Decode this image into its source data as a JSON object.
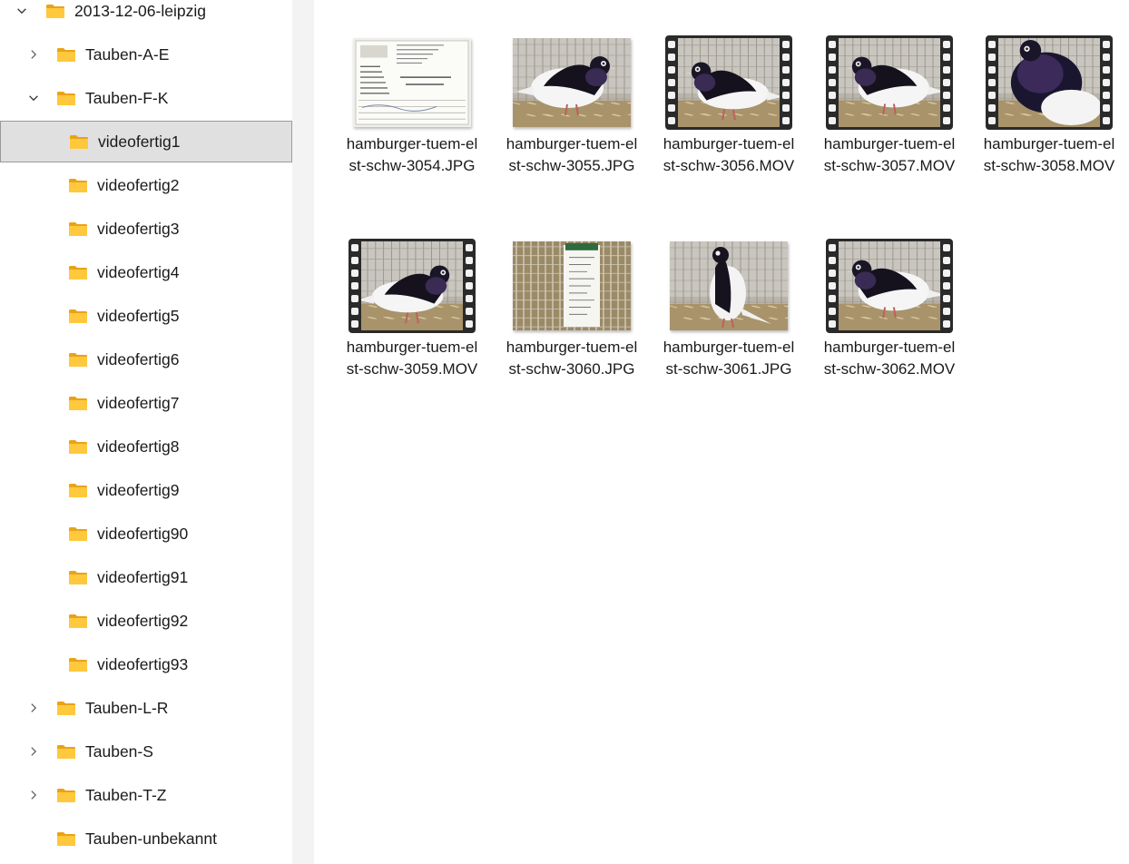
{
  "tree": [
    {
      "label": "2013-12-06-leipzig",
      "level": 0,
      "expanded": true,
      "chevron": "down"
    },
    {
      "label": "Tauben-A-E",
      "level": 1,
      "expanded": false,
      "chevron": "right"
    },
    {
      "label": "Tauben-F-K",
      "level": 1,
      "expanded": true,
      "chevron": "down"
    },
    {
      "label": "videofertig1",
      "level": 2,
      "selected": true
    },
    {
      "label": "videofertig2",
      "level": 2
    },
    {
      "label": "videofertig3",
      "level": 2
    },
    {
      "label": "videofertig4",
      "level": 2
    },
    {
      "label": "videofertig5",
      "level": 2
    },
    {
      "label": "videofertig6",
      "level": 2
    },
    {
      "label": "videofertig7",
      "level": 2
    },
    {
      "label": "videofertig8",
      "level": 2
    },
    {
      "label": "videofertig9",
      "level": 2
    },
    {
      "label": "videofertig90",
      "level": 2
    },
    {
      "label": "videofertig91",
      "level": 2
    },
    {
      "label": "videofertig92",
      "level": 2
    },
    {
      "label": "videofertig93",
      "level": 2
    },
    {
      "label": "Tauben-L-R",
      "level": 1,
      "expanded": false,
      "chevron": "right"
    },
    {
      "label": "Tauben-S",
      "level": 1,
      "expanded": false,
      "chevron": "right"
    },
    {
      "label": "Tauben-T-Z",
      "level": 1,
      "expanded": false,
      "chevron": "right"
    },
    {
      "label": "Tauben-unbekannt",
      "level": 1,
      "chevron": "none"
    }
  ],
  "files": [
    {
      "name": "hamburger-tuem-elst-schw-3054.JPG",
      "kind": "photo",
      "thumb": "document"
    },
    {
      "name": "hamburger-tuem-elst-schw-3055.JPG",
      "kind": "photo",
      "thumb": "pigeon-left"
    },
    {
      "name": "hamburger-tuem-elst-schw-3056.MOV",
      "kind": "video",
      "thumb": "pigeon-right-low"
    },
    {
      "name": "hamburger-tuem-elst-schw-3057.MOV",
      "kind": "video",
      "thumb": "pigeon-right"
    },
    {
      "name": "hamburger-tuem-elst-schw-3058.MOV",
      "kind": "video",
      "thumb": "pigeon-close"
    },
    {
      "name": "hamburger-tuem-elst-schw-3059.MOV",
      "kind": "video",
      "thumb": "pigeon-left-low"
    },
    {
      "name": "hamburger-tuem-elst-schw-3060.JPG",
      "kind": "photo",
      "thumb": "cage-card"
    },
    {
      "name": "hamburger-tuem-elst-schw-3061.JPG",
      "kind": "photo",
      "thumb": "pigeon-standing"
    },
    {
      "name": "hamburger-tuem-elst-schw-3062.MOV",
      "kind": "video",
      "thumb": "pigeon-right"
    }
  ],
  "icons": {
    "folder": "folder-icon",
    "chevron_down": "chevron-down-icon",
    "chevron_right": "chevron-right-icon",
    "video": "film-strip-icon"
  },
  "colors": {
    "selection": "#e0e0e0",
    "folder": "#ffc83d",
    "folder_dark": "#e8a317",
    "pane_divider": "#f3f3f3"
  }
}
